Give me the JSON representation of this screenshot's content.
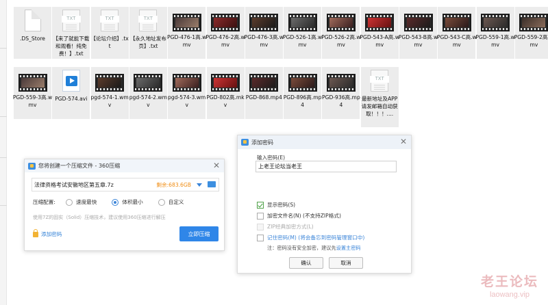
{
  "files": [
    {
      "name": ".DS_Store",
      "kind": "blank"
    },
    {
      "name": "【来了就能下载和观看！纯免费！】.txt",
      "kind": "txt"
    },
    {
      "name": "【论坛介绍】.txt",
      "kind": "txt"
    },
    {
      "name": "【永久地址发布页】.txt",
      "kind": "txt"
    },
    {
      "name": "PGD-476-1高.wmv",
      "kind": "video"
    },
    {
      "name": "PGD-476-2高.wmv",
      "kind": "video"
    },
    {
      "name": "PGD-476-3高.wmv",
      "kind": "video"
    },
    {
      "name": "PGD-526-1高.wmv",
      "kind": "video"
    },
    {
      "name": "PGD-526-2高.wmv",
      "kind": "video"
    },
    {
      "name": "PGD-543-A高.wmv",
      "kind": "video"
    },
    {
      "name": "PGD-543-B高.wmv",
      "kind": "video"
    },
    {
      "name": "PGD-543-C高.wmv",
      "kind": "video"
    },
    {
      "name": "PGD-559-1高.wmv",
      "kind": "video"
    },
    {
      "name": "PGD-559-2高.wmv",
      "kind": "video"
    },
    {
      "name": "PGD-559-3高.wmv",
      "kind": "video"
    },
    {
      "name": "PGD-574.avi",
      "kind": "avi"
    },
    {
      "name": "pgd-574-1.wmv",
      "kind": "video"
    },
    {
      "name": "pgd-574-2.wmv",
      "kind": "video"
    },
    {
      "name": "pgd-574-3.wmv",
      "kind": "video"
    },
    {
      "name": "PGD-802高.mkv",
      "kind": "video"
    },
    {
      "name": "PGD-868.mp4",
      "kind": "video"
    },
    {
      "name": "PGD-896高.mp4",
      "kind": "video"
    },
    {
      "name": "PGD-936高.mp4",
      "kind": "video"
    },
    {
      "name": "最新地址及APP请发邮箱自动获取！！！....",
      "kind": "txt"
    }
  ],
  "txt_icon_label": "TXT",
  "compress_dialog": {
    "title": "您将创建一个压缩文件 - 360压缩",
    "filename": "法律资格考试安徽地区第五章.7z",
    "remaining": "剩余:683.6GB",
    "config_label": "压缩配置:",
    "options": [
      "速度最快",
      "体积最小",
      "自定义"
    ],
    "selected_option": "体积最小",
    "hint": "使用7Z的固实（Solid）压缩技术，建议使用360压缩进行解压",
    "add_password": "添加密码",
    "start_button": "立即压缩"
  },
  "password_dialog": {
    "title": "添加密码",
    "input_label": "输入密码(E)",
    "password_value": "上老王论坛当老王",
    "show_password": "显示密码(S)",
    "encrypt_filenames": "加密文件名(N) (不支持ZIP格式)",
    "zip_classic": "ZIP经典加密方式(L)",
    "remember_password": "记住密码(M) (将会备忘到密码管理窗口中)",
    "note_prefix": "注：密码没有安全加密，建议先",
    "note_link": "设置主密码",
    "ok_button": "确认",
    "cancel_button": "取消"
  },
  "watermark": {
    "line1": "老王论坛",
    "line2": "laowang.vip"
  },
  "colors": {
    "accent": "#2f86e8",
    "warning": "#f08c12",
    "check": "#3c9a35"
  }
}
